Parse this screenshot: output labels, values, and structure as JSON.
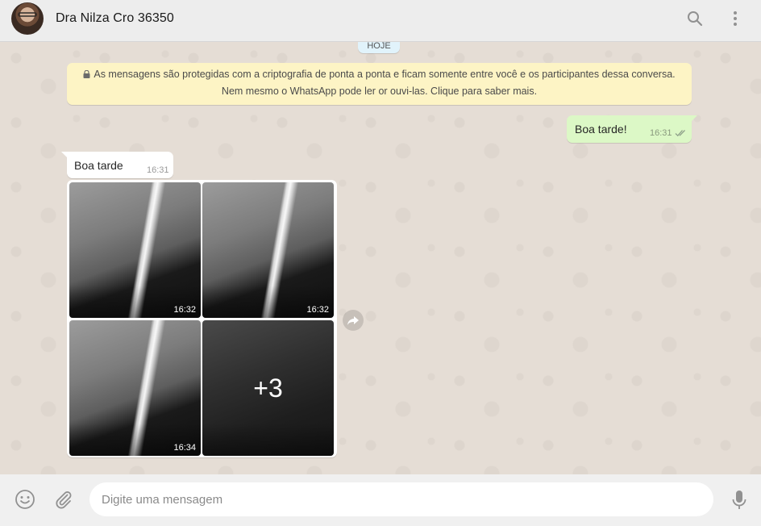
{
  "header": {
    "contact_name": "Dra Nilza Cro 36350",
    "icons": [
      "search-icon",
      "menu-icon"
    ]
  },
  "chat": {
    "day_chip": "HOJE",
    "encryption_notice": {
      "line1": "As mensagens são protegidas com a criptografia de ponta a ponta e ficam somente entre você e os participantes dessa conversa.",
      "line2": "Nem mesmo o WhatsApp pode ler or ouvi-las. Clique para saber mais."
    },
    "outgoing": {
      "text": "Boa tarde!",
      "time": "16:31"
    },
    "incoming": {
      "text": "Boa tarde",
      "time": "16:31"
    },
    "album": {
      "photos": [
        {
          "time": "16:32"
        },
        {
          "time": "16:32"
        },
        {
          "time": "16:34"
        },
        {
          "more_count": "+3"
        }
      ]
    }
  },
  "footer": {
    "placeholder": "Digite uma mensagem",
    "icons": [
      "emoji-icon",
      "attach-icon",
      "mic-icon"
    ]
  },
  "colors": {
    "header_bg": "#ededed",
    "chat_bg": "#e5ddd5",
    "outgoing_bubble": "#dcf8c6",
    "incoming_bubble": "#ffffff",
    "notice_bg": "#fdf4c5"
  }
}
